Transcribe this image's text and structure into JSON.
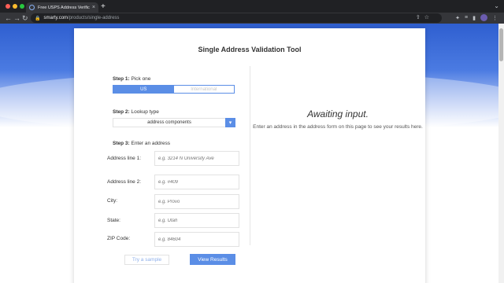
{
  "browser": {
    "tab_title": "Free USPS Address Verificatio",
    "tab_close": "×",
    "new_tab": "+",
    "url_host": "smarty.com",
    "url_path": "/products/single-address",
    "back": "←",
    "forward": "→",
    "reload": "↻",
    "tabs_menu": "⌄"
  },
  "page": {
    "title": "Single Address Validation Tool",
    "step1": {
      "label": "Step 1:",
      "text": "Pick one"
    },
    "toggle": {
      "us": "US",
      "international": "International"
    },
    "step2": {
      "label": "Step 2:",
      "text": "Lookup type"
    },
    "lookup_type": "address components",
    "step3": {
      "label": "Step 3:",
      "text": "Enter an address"
    },
    "fields": {
      "address1": {
        "label": "Address line 1:",
        "placeholder": "e.g. 3214 N University Ave"
      },
      "address2": {
        "label": "Address line 2:",
        "placeholder": "e.g. #409"
      },
      "city": {
        "label": "City:",
        "placeholder": "e.g. Provo"
      },
      "state": {
        "label": "State:",
        "placeholder": "e.g. Utah"
      },
      "zip": {
        "label": "ZIP Code:",
        "placeholder": "e.g. 84604"
      }
    },
    "try_sample": "Try a sample",
    "view_results": "View Results",
    "awaiting_title": "Awaiting input.",
    "awaiting_text": "Enter an address in the address form on this page to see your results here."
  },
  "colors": {
    "accent": "#5b8ee6",
    "header_blue": "#2f5fd0"
  }
}
